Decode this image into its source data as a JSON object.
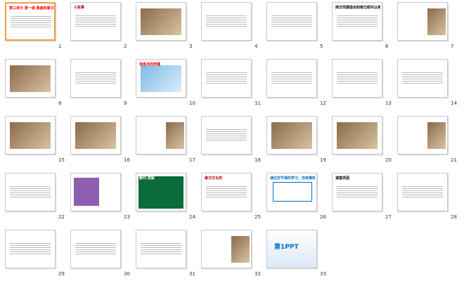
{
  "slides": [
    {
      "n": "1",
      "theme": "title",
      "caption": "第三单元 第一课 鼎盛的秦汉文化(一)",
      "accent": "#ff0000"
    },
    {
      "n": "2",
      "theme": "story",
      "caption": "小故事",
      "accent": "#c00000"
    },
    {
      "n": "3",
      "theme": "photos",
      "caption": "",
      "accent": "#ffffff"
    },
    {
      "n": "4",
      "theme": "text",
      "caption": "",
      "accent": "#7030a0"
    },
    {
      "n": "5",
      "theme": "bubble",
      "caption": "",
      "accent": "#ff0000"
    },
    {
      "n": "6",
      "theme": "text",
      "caption": "西汉早期造出的纸已经可以用于书写文字和绘图，但是纸比较粗糙，不便书写。",
      "accent": "#000000"
    },
    {
      "n": "7",
      "theme": "portrait",
      "caption": "",
      "accent": "#c00000"
    },
    {
      "n": "8",
      "theme": "photos",
      "caption": "",
      "accent": "#000000"
    },
    {
      "n": "9",
      "theme": "list",
      "caption": "",
      "accent": "#ff0000"
    },
    {
      "n": "10",
      "theme": "map",
      "caption": "造纸术的传播",
      "accent": "#ff0000"
    },
    {
      "n": "11",
      "theme": "bubble",
      "caption": "",
      "accent": "#7030a0"
    },
    {
      "n": "12",
      "theme": "text",
      "caption": "",
      "accent": "#c00000"
    },
    {
      "n": "13",
      "theme": "book",
      "caption": "",
      "accent": "#ff0000"
    },
    {
      "n": "14",
      "theme": "text",
      "caption": "",
      "accent": "#c00000"
    },
    {
      "n": "15",
      "theme": "photos",
      "caption": "",
      "accent": "#000000"
    },
    {
      "n": "16",
      "theme": "photos",
      "caption": "",
      "accent": "#000000"
    },
    {
      "n": "17",
      "theme": "portrait",
      "caption": "",
      "accent": "#ff0000"
    },
    {
      "n": "18",
      "theme": "list",
      "caption": "",
      "accent": "#000000"
    },
    {
      "n": "19",
      "theme": "photos",
      "caption": "",
      "accent": "#000000"
    },
    {
      "n": "20",
      "theme": "photos",
      "caption": "",
      "accent": "#ff0000"
    },
    {
      "n": "21",
      "theme": "portrait",
      "caption": "",
      "accent": "#ff0000"
    },
    {
      "n": "22",
      "theme": "list",
      "caption": "",
      "accent": "#ff0000"
    },
    {
      "n": "23",
      "theme": "purple",
      "caption": "",
      "accent": "#7030a0"
    },
    {
      "n": "24",
      "theme": "table",
      "caption": "朝代 成就",
      "accent": "#00a651"
    },
    {
      "n": "25",
      "theme": "tree",
      "caption": "秦汉文化的",
      "accent": "#c00000"
    },
    {
      "n": "26",
      "theme": "box",
      "caption": "通过这节课的学习，你有哪些收获和体会？",
      "accent": "#0070c0"
    },
    {
      "n": "27",
      "theme": "quiz",
      "caption": "课堂巩固",
      "accent": "#000000"
    },
    {
      "n": "28",
      "theme": "quiz",
      "caption": "",
      "accent": "#000000"
    },
    {
      "n": "29",
      "theme": "quiz",
      "caption": "",
      "accent": "#000000"
    },
    {
      "n": "30",
      "theme": "quiz",
      "caption": "",
      "accent": "#000000"
    },
    {
      "n": "31",
      "theme": "quiz",
      "caption": "",
      "accent": "#000000"
    },
    {
      "n": "32",
      "theme": "portrait",
      "caption": "",
      "accent": "#000000"
    },
    {
      "n": "33",
      "theme": "logo",
      "caption": "第1PPT",
      "accent": "#0070c0"
    }
  ]
}
